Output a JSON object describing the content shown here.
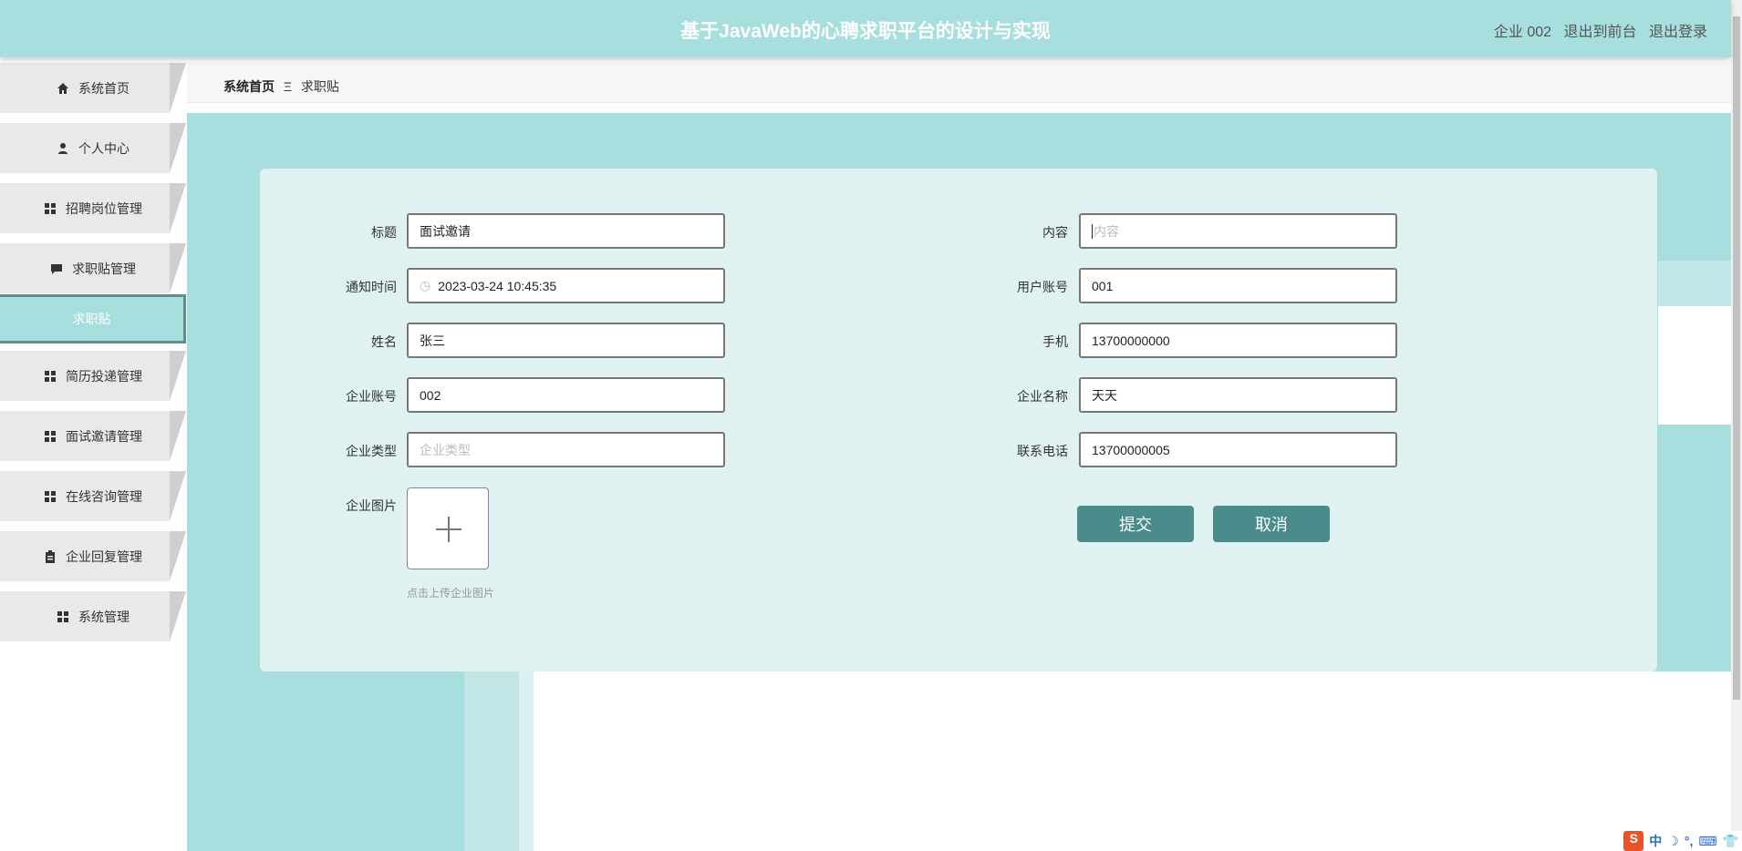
{
  "header": {
    "title": "基于JavaWeb的心聘求职平台的设计与实现",
    "user": "企业 002",
    "to_front": "退出到前台",
    "logout": "退出登录"
  },
  "sidebar": {
    "items": [
      {
        "label": "系统首页",
        "icon": "home-icon"
      },
      {
        "label": "个人中心",
        "icon": "user-icon"
      },
      {
        "label": "招聘岗位管理",
        "icon": "grid-icon"
      },
      {
        "label": "求职贴管理",
        "icon": "comment-icon"
      },
      {
        "label": "求职贴",
        "active": true
      },
      {
        "label": "简历投递管理",
        "icon": "grid-icon"
      },
      {
        "label": "面试邀请管理",
        "icon": "grid-icon"
      },
      {
        "label": "在线咨询管理",
        "icon": "grid-icon"
      },
      {
        "label": "企业回复管理",
        "icon": "clipboard-icon"
      },
      {
        "label": "系统管理",
        "icon": "grid-icon"
      }
    ]
  },
  "breadcrumb": {
    "home": "系统首页",
    "sep": "Ξ",
    "current": "求职贴"
  },
  "form": {
    "title": {
      "label": "标题",
      "value": "面试邀请"
    },
    "content": {
      "label": "内容",
      "placeholder": "内容"
    },
    "notify_time": {
      "label": "通知时间",
      "value": "2023-03-24 10:45:35"
    },
    "user_account": {
      "label": "用户账号",
      "value": "001"
    },
    "name": {
      "label": "姓名",
      "value": "张三"
    },
    "phone": {
      "label": "手机",
      "value": "13700000000"
    },
    "company_account": {
      "label": "企业账号",
      "value": "002"
    },
    "company_name": {
      "label": "企业名称",
      "value": "天天"
    },
    "company_type": {
      "label": "企业类型",
      "placeholder": "企业类型"
    },
    "contact_phone": {
      "label": "联系电话",
      "value": "13700000005"
    },
    "company_image": {
      "label": "企业图片",
      "hint": "点击上传企业图片"
    },
    "submit": "提交",
    "cancel": "取消"
  },
  "ime": {
    "lang": "中",
    "logo": "S"
  },
  "colors": {
    "primary": "#a7dede",
    "button": "#4a8c8c",
    "card": "#dff1f1"
  }
}
